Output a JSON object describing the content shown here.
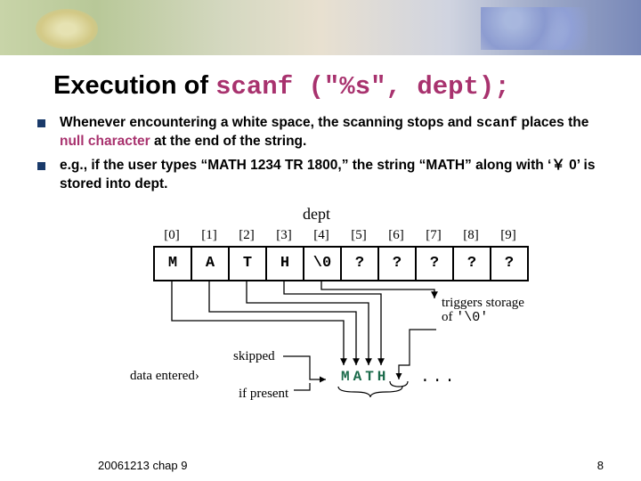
{
  "title": {
    "prefix": "Execution of ",
    "code": "scanf (\"%s\", dept);"
  },
  "bullets": [
    {
      "t1": "Whenever encountering a white space, the scanning stops and ",
      "code": "scanf",
      "t2": " places the ",
      "nullchar": "null character",
      "t3": " at the end of the string."
    },
    {
      "t1": " e.g., if the user types “MATH 1234 TR 1800,” the string “MATH” along with ‘￥ 0’ is stored into dept."
    }
  ],
  "diagram": {
    "dept_label": "dept",
    "indices": [
      "[0]",
      "[1]",
      "[2]",
      "[3]",
      "[4]",
      "[5]",
      "[6]",
      "[7]",
      "[8]",
      "[9]"
    ],
    "cells": [
      "M",
      "A",
      "T",
      "H",
      "\\0",
      "?",
      "?",
      "?",
      "?",
      "?"
    ],
    "triggers_l1": "triggers storage",
    "triggers_l2": "of ",
    "triggers_code": "'\\0'",
    "skipped": "skipped",
    "data_entered": "data entered›",
    "if_present": "if present",
    "math_text": "MATH",
    "dots": "..."
  },
  "footer": {
    "left": "20061213    chap 9",
    "right": "8"
  }
}
